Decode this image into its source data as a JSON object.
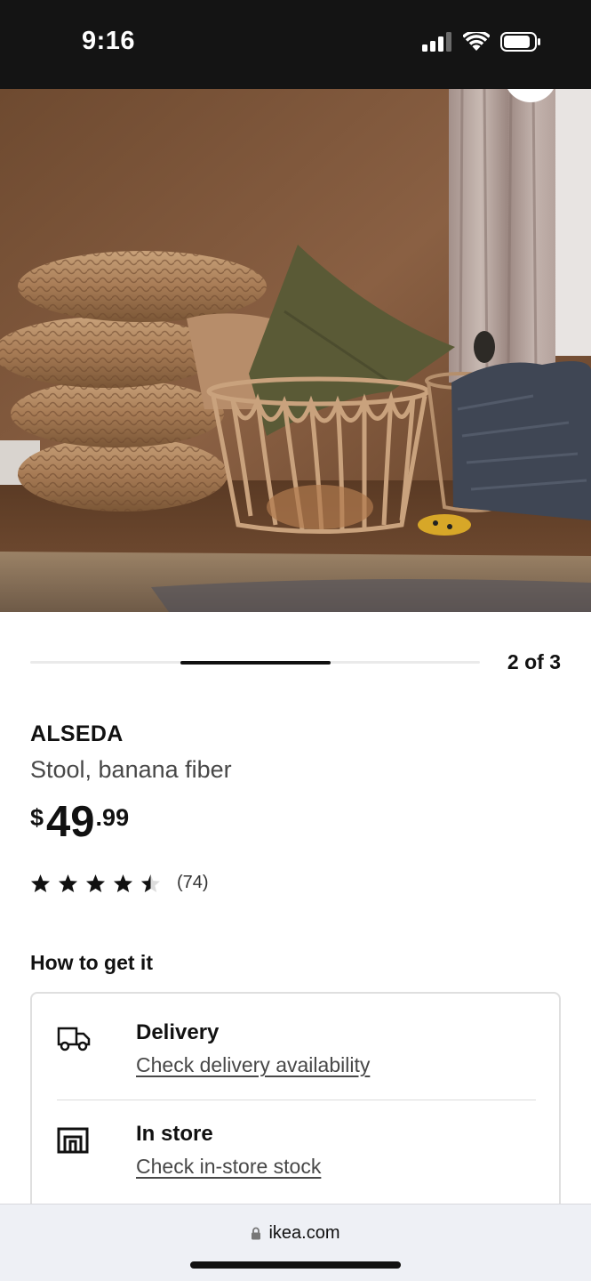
{
  "status_bar": {
    "time": "9:16"
  },
  "carousel": {
    "counter": "2 of 3",
    "current": 2,
    "total": 3
  },
  "product": {
    "name": "ALSEDA",
    "description": "Stool, banana fiber",
    "price": {
      "currency": "$",
      "integer": "49",
      "decimal": ".99"
    },
    "rating": {
      "stars": 4.5,
      "max": 5,
      "count_label": "(74)"
    }
  },
  "how_to_get": {
    "title": "How to get it",
    "options": [
      {
        "icon": "truck-icon",
        "label": "Delivery",
        "link": "Check delivery availability"
      },
      {
        "icon": "store-icon",
        "label": "In store",
        "link": "Check in-store stock"
      }
    ]
  },
  "browser": {
    "url": "ikea.com"
  },
  "colors": {
    "status_bar_bg": "#141414",
    "text": "#111111",
    "muted_text": "#484848",
    "card_border": "#dfdfdf"
  }
}
